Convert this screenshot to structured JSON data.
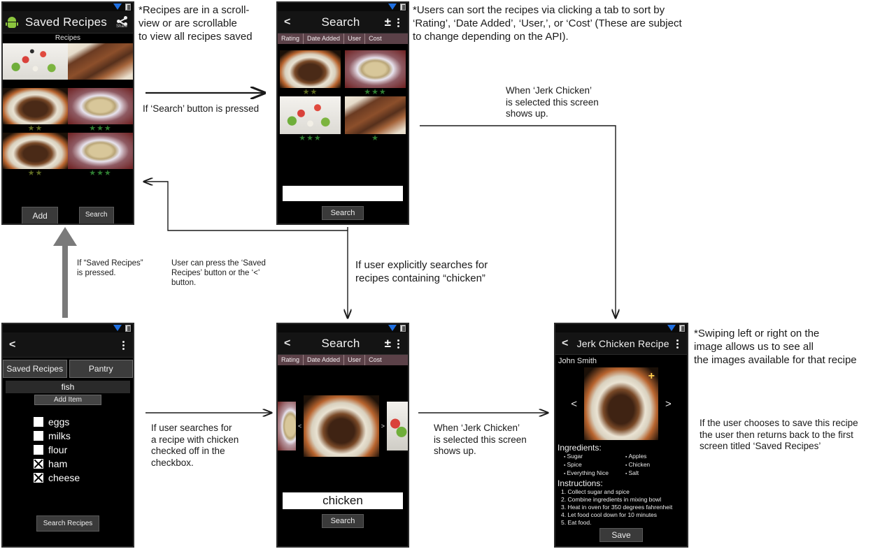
{
  "screens": {
    "saved_recipes": {
      "title": "Saved Recipes",
      "share_label": "Share",
      "subtitle": "Recipes",
      "ratings": [
        "",
        "",
        "★★",
        "★★★",
        "★★",
        "★★★"
      ],
      "add_label": "Add",
      "search_label": "Search"
    },
    "search_empty": {
      "title": "Search",
      "back": "<",
      "sort_icon": "±",
      "tabs": [
        "Rating",
        "Date Added",
        "User",
        "Cost"
      ],
      "ratings": [
        "★★",
        "★★★",
        "★★★",
        "★"
      ],
      "query": "",
      "search_label": "Search"
    },
    "search_chicken": {
      "title": "Search",
      "back": "<",
      "sort_icon": "±",
      "tabs": [
        "Rating",
        "Date Added",
        "User",
        "Cost"
      ],
      "prev_arrow": "<",
      "next_arrow": ">",
      "query": "chicken",
      "search_label": "Search"
    },
    "pantry": {
      "back": "<",
      "tabs": [
        "Saved Recipes",
        "Pantry"
      ],
      "item_value": "fish",
      "add_item_label": "Add Item",
      "items": [
        {
          "label": "eggs",
          "checked": false
        },
        {
          "label": "milks",
          "checked": false
        },
        {
          "label": "flour",
          "checked": false
        },
        {
          "label": "ham",
          "checked": true
        },
        {
          "label": "cheese",
          "checked": true
        }
      ],
      "search_recipes_label": "Search Recipes"
    },
    "recipe_detail": {
      "back": "<",
      "title": "Jerk Chicken Recipe",
      "author": "John Smith",
      "prev_arrow": "<",
      "next_arrow": ">",
      "add_image_icon": "+",
      "ingredients_heading": "Ingredients:",
      "ingredients_col1": [
        "Sugar",
        "Spice",
        "Everything Nice"
      ],
      "ingredients_col2": [
        "Apples",
        "Chicken",
        "Salt"
      ],
      "instructions_heading": "Instructions:",
      "instructions": [
        "1. Collect sugar and spice",
        "2. Combine ingredients in mixing bowl",
        "3. Heat in oven for 350 degrees fahrenheit",
        "4. Let food cool down for 10 minutes",
        "5. Eat food."
      ],
      "save_label": "Save"
    }
  },
  "annotations": {
    "scrollview": "*Recipes are in a scroll-\nview or are scrollable\nto view all recipes saved",
    "sort_tabs": "*Users can sort the recipes via clicking a tab to sort by\n‘Rating’, ‘Date Added’, ‘User,’, or ‘Cost’ (These are subject\nto change depending on the API).",
    "search_pressed": "If ‘Search’ button is pressed",
    "jerk_selected_top": "When ‘Jerk Chicken’\nis selected this screen\nshows up.",
    "saved_recipes_pressed": "If “Saved Recipes”\nis pressed.",
    "user_can_press": "User can press the ‘Saved\nRecipes’ button or the ‘<’\nbutton.",
    "explicit_search": "If user explicitly searches for\nrecipes containing “chicken”",
    "search_with_chicken": "If user searches for\na recipe with chicken\nchecked off in the\ncheckbox.",
    "jerk_selected_bottom": "When ‘Jerk Chicken’\nis selected this screen\nshows up.",
    "swiping": "*Swiping left or right on the\nimage allows us to see all\nthe images available for that recipe",
    "save_returns": "If the user chooses to save this recipe\nthe user then returns back to the first\nscreen titled ‘Saved Recipes’"
  },
  "colors": {
    "tabbar": "#5b4148",
    "star_green": "#2f7d32",
    "android_green": "#8cc63e",
    "screen_bg": "#000000"
  }
}
